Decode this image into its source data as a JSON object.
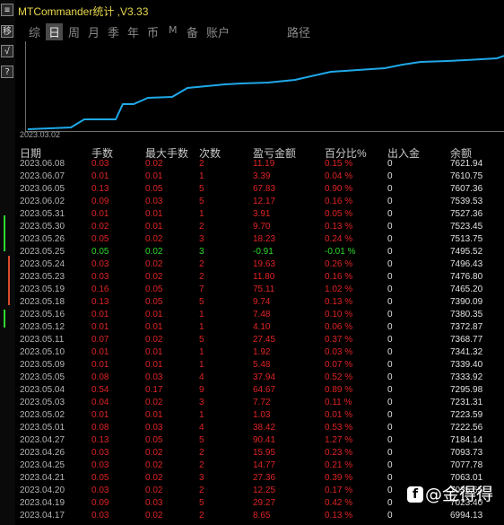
{
  "window": {
    "title": "MTCommander统计 ,V3.33",
    "left_buttons": [
      "≡",
      "移",
      "√",
      "?"
    ]
  },
  "tabs": [
    {
      "label": "综",
      "active": false
    },
    {
      "label": "日",
      "active": true
    },
    {
      "label": "周",
      "active": false
    },
    {
      "label": "月",
      "active": false
    },
    {
      "label": "季",
      "active": false
    },
    {
      "label": "年",
      "active": false
    },
    {
      "label": "币",
      "active": false
    },
    {
      "label": "M",
      "active": false
    },
    {
      "label": "备",
      "active": false
    },
    {
      "label": "账户",
      "active": false
    },
    {
      "label": "路径",
      "active": false
    }
  ],
  "equity_chart": {
    "start_label": "2023.03.02",
    "line_color": "#1fa8e8"
  },
  "table": {
    "headers": [
      "日期",
      "手数",
      "最大手数",
      "次数",
      "盈亏金额",
      "百分比%",
      "出入金",
      "余额"
    ],
    "rows": [
      [
        "2023.06.08",
        "0.03",
        "0.02",
        "2",
        "11.19",
        "0.15 %",
        "0",
        "7621.94"
      ],
      [
        "2023.06.07",
        "0.01",
        "0.01",
        "1",
        "3.39",
        "0.04 %",
        "0",
        "7610.75"
      ],
      [
        "2023.06.05",
        "0.13",
        "0.05",
        "5",
        "67.83",
        "0.90 %",
        "0",
        "7607.36"
      ],
      [
        "2023.06.02",
        "0.09",
        "0.03",
        "5",
        "12.17",
        "0.16 %",
        "0",
        "7539.53"
      ],
      [
        "2023.05.31",
        "0.01",
        "0.01",
        "1",
        "3.91",
        "0.05 %",
        "0",
        "7527.36"
      ],
      [
        "2023.05.30",
        "0.02",
        "0.01",
        "2",
        "9.70",
        "0.13 %",
        "0",
        "7523.45"
      ],
      [
        "2023.05.26",
        "0.05",
        "0.02",
        "3",
        "18.23",
        "0.24 %",
        "0",
        "7513.75"
      ],
      [
        "2023.05.25",
        "0.05",
        "0.02",
        "3",
        "-0.91",
        "-0.01 %",
        "0",
        "7495.52"
      ],
      [
        "2023.05.24",
        "0.03",
        "0.02",
        "2",
        "19.63",
        "0.26 %",
        "0",
        "7496.43"
      ],
      [
        "2023.05.23",
        "0.03",
        "0.02",
        "2",
        "11.80",
        "0.16 %",
        "0",
        "7476.80"
      ],
      [
        "2023.05.19",
        "0.16",
        "0.05",
        "7",
        "75.11",
        "1.02 %",
        "0",
        "7465.20"
      ],
      [
        "2023.05.18",
        "0.13",
        "0.05",
        "5",
        "9.74",
        "0.13 %",
        "0",
        "7390.09"
      ],
      [
        "2023.05.16",
        "0.01",
        "0.01",
        "1",
        "7.48",
        "0.10 %",
        "0",
        "7380.35"
      ],
      [
        "2023.05.12",
        "0.01",
        "0.01",
        "1",
        "4.10",
        "0.06 %",
        "0",
        "7372.87"
      ],
      [
        "2023.05.11",
        "0.07",
        "0.02",
        "5",
        "27.45",
        "0.37 %",
        "0",
        "7368.77"
      ],
      [
        "2023.05.10",
        "0.01",
        "0.01",
        "1",
        "1.92",
        "0.03 %",
        "0",
        "7341.32"
      ],
      [
        "2023.05.09",
        "0.01",
        "0.01",
        "1",
        "5.48",
        "0.07 %",
        "0",
        "7339.40"
      ],
      [
        "2023.05.05",
        "0.08",
        "0.03",
        "4",
        "37.94",
        "0.52 %",
        "0",
        "7333.92"
      ],
      [
        "2023.05.04",
        "0.54",
        "0.17",
        "9",
        "64.67",
        "0.89 %",
        "0",
        "7295.98"
      ],
      [
        "2023.05.03",
        "0.04",
        "0.02",
        "3",
        "7.72",
        "0.11 %",
        "0",
        "7231.31"
      ],
      [
        "2023.05.02",
        "0.01",
        "0.01",
        "1",
        "1.03",
        "0.01 %",
        "0",
        "7223.59"
      ],
      [
        "2023.05.01",
        "0.08",
        "0.03",
        "4",
        "38.42",
        "0.53 %",
        "0",
        "7222.56"
      ],
      [
        "2023.04.27",
        "0.13",
        "0.05",
        "5",
        "90.41",
        "1.27 %",
        "0",
        "7184.14"
      ],
      [
        "2023.04.26",
        "0.03",
        "0.02",
        "2",
        "15.95",
        "0.23 %",
        "0",
        "7093.73"
      ],
      [
        "2023.04.25",
        "0.03",
        "0.02",
        "2",
        "14.77",
        "0.21 %",
        "0",
        "7077.78"
      ],
      [
        "2023.04.21",
        "0.05",
        "0.02",
        "3",
        "27.36",
        "0.39 %",
        "0",
        "7063.01"
      ],
      [
        "2023.04.20",
        "0.03",
        "0.02",
        "2",
        "12.25",
        "0.17 %",
        "0",
        "7035.65"
      ],
      [
        "2023.04.19",
        "0.09",
        "0.03",
        "5",
        "29.27",
        "0.42 %",
        "0",
        "7023.40"
      ],
      [
        "2023.04.17",
        "0.03",
        "0.02",
        "2",
        "8.65",
        "0.13 %",
        "0",
        "6994.13"
      ]
    ]
  },
  "colors": {
    "profit": "#e02424",
    "loss": "#2fd92f",
    "date": "#b4b4b4",
    "balance": "#e0e0e0",
    "title": "#e8d84a"
  },
  "watermark": {
    "icon": "f",
    "text": "@金得得"
  }
}
